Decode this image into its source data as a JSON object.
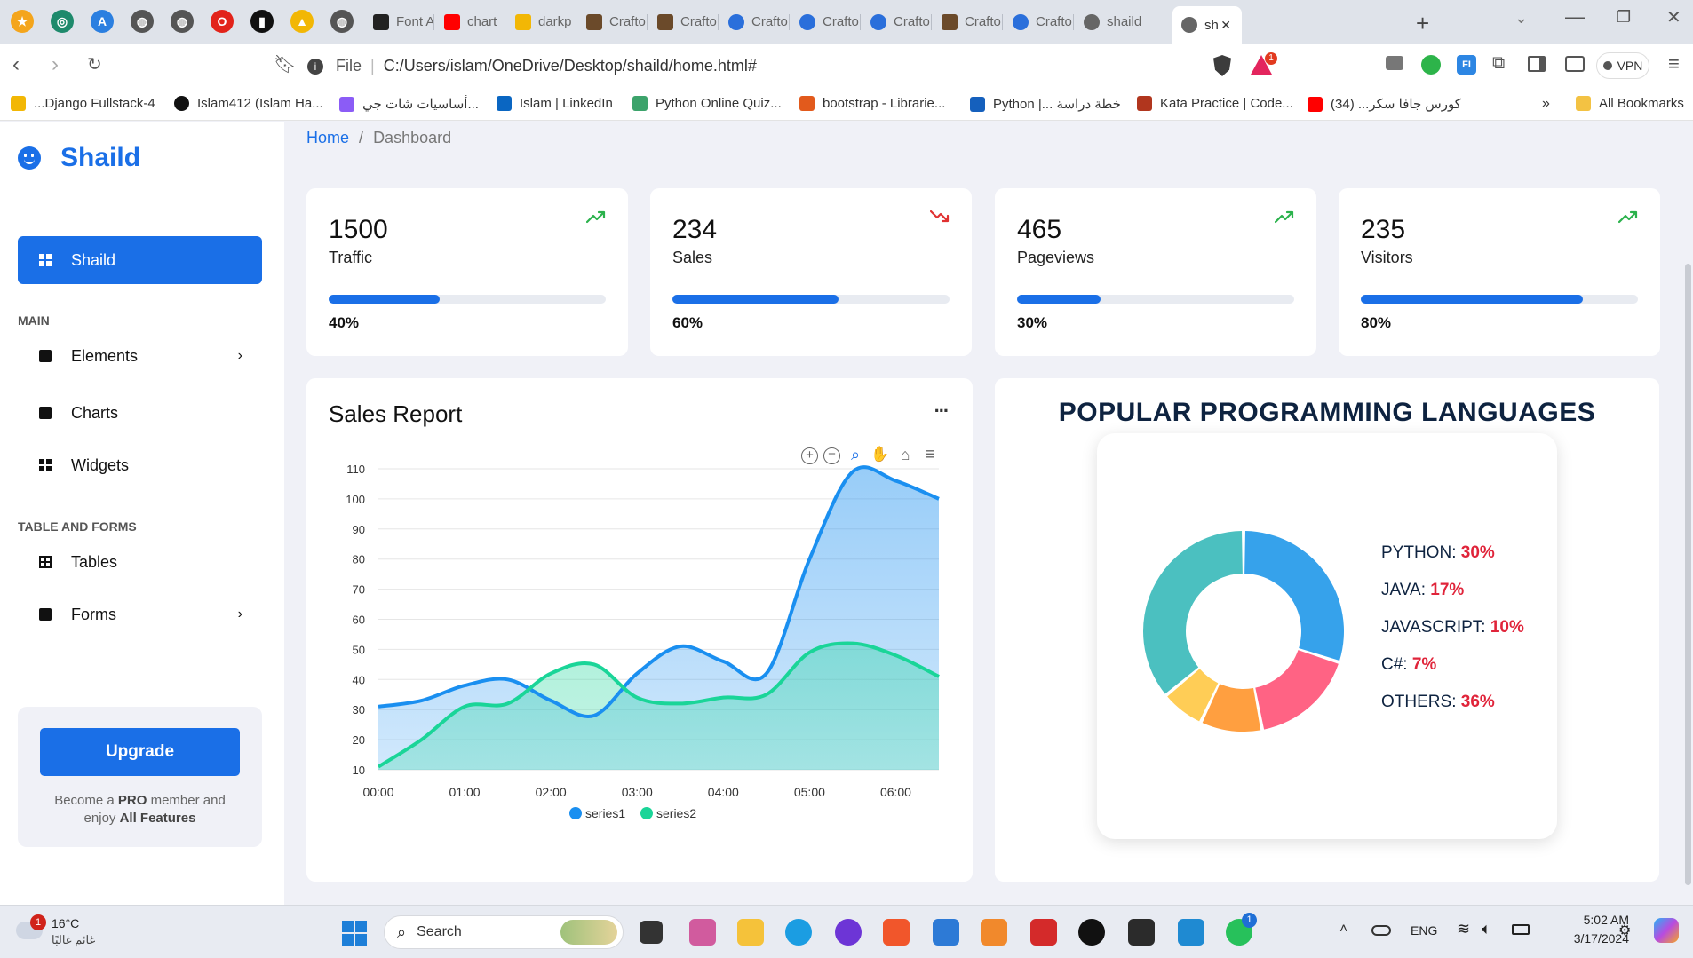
{
  "browser": {
    "tabs": [
      {
        "label": "Font A",
        "icon": "page-icon"
      },
      {
        "label": "chart",
        "icon": "youtube-icon"
      },
      {
        "label": "darkp",
        "icon": "drive-icon"
      },
      {
        "label": "Crafto",
        "icon": "crafto-icon"
      },
      {
        "label": "Crafto",
        "icon": "crafto-icon"
      },
      {
        "label": "Crafto",
        "icon": "crafto-c-icon"
      },
      {
        "label": "Crafto",
        "icon": "crafto-c-icon"
      },
      {
        "label": "Crafto",
        "icon": "crafto-c-icon"
      },
      {
        "label": "Crafto",
        "icon": "crafto-icon"
      },
      {
        "label": "Crafto",
        "icon": "crafto-c-icon"
      },
      {
        "label": "shaild",
        "icon": "globe-icon"
      },
      {
        "label": "sh",
        "icon": "globe-icon",
        "active": true
      }
    ],
    "url_scheme": "File",
    "url": "C:/Users/islam/OneDrive/Desktop/shaild/home.html#",
    "vpn_label": "VPN",
    "bookmarks": [
      "...Django Fullstack-4",
      "Islam412 (Islam Ha...",
      "أساسيات شات جي...",
      "Islam | LinkedIn",
      "Python Online Quiz...",
      "bootstrap - Librarie...",
      "Python |... خطة دراسة",
      "Kata Practice | Code...",
      "كورس جافا سكر... (34)"
    ],
    "all_bookmarks": "All Bookmarks",
    "brave_badge": "1"
  },
  "sidebar": {
    "brand": "Shaild",
    "active_item": "Shaild",
    "section_main": "MAIN",
    "main_items": [
      "Elements",
      "Charts",
      "Widgets"
    ],
    "section_tables": "TABLE AND FORMS",
    "table_items": [
      "Tables",
      "Forms"
    ],
    "upgrade_button": "Upgrade",
    "upgrade_text_1": "Become a ",
    "upgrade_text_pro": "PRO",
    "upgrade_text_2": " member and",
    "upgrade_text_3": "enjoy ",
    "upgrade_text_all": "All Features"
  },
  "breadcrumb": {
    "home": "Home",
    "separator": "/",
    "current": "Dashboard"
  },
  "kpis": [
    {
      "value": "1500",
      "label": "Traffic",
      "progress": 40,
      "progress_label": "40%",
      "trend": "up"
    },
    {
      "value": "234",
      "label": "Sales",
      "progress": 60,
      "progress_label": "60%",
      "trend": "down"
    },
    {
      "value": "465",
      "label": "Pageviews",
      "progress": 30,
      "progress_label": "30%",
      "trend": "up"
    },
    {
      "value": "235",
      "label": "Visitors",
      "progress": 80,
      "progress_label": "80%",
      "trend": "up"
    }
  ],
  "sales_report": {
    "title": "Sales Report",
    "menu": "...",
    "chart_data": {
      "type": "area",
      "x": [
        "00:00",
        "01:00",
        "02:00",
        "03:00",
        "04:00",
        "05:00",
        "06:00"
      ],
      "xlim": [
        0,
        6.5
      ],
      "x_points": [
        0,
        0.5,
        1,
        1.5,
        2,
        2.5,
        3,
        3.5,
        4,
        4.5,
        5,
        5.5,
        6,
        6.5
      ],
      "ylim": [
        10,
        110
      ],
      "yticks": [
        10,
        20,
        30,
        40,
        50,
        60,
        70,
        80,
        90,
        100,
        110
      ],
      "grid": true,
      "legend": "bottom",
      "series": [
        {
          "name": "series1",
          "color": "#1a8ff0",
          "values": [
            31,
            33,
            38,
            40,
            33,
            28,
            42,
            51,
            46,
            42,
            80,
            109,
            106,
            100
          ]
        },
        {
          "name": "series2",
          "color": "#1ad598",
          "values": [
            11,
            20,
            31,
            32,
            42,
            45,
            34,
            32,
            34,
            35,
            49,
            52,
            48,
            41
          ]
        }
      ]
    }
  },
  "languages": {
    "title": "POPULAR PROGRAMMING LANGUAGES",
    "chart_data": {
      "type": "pie",
      "labels": [
        "PYTHON",
        "JAVA",
        "JAVASCRIPT",
        "C#",
        "OTHERS"
      ],
      "values": [
        30,
        17,
        10,
        7,
        36
      ],
      "value_labels": [
        "30%",
        "17%",
        "10%",
        "7%",
        "36%"
      ],
      "colors": [
        "#36a2eb",
        "#ff6384",
        "#ff9f40",
        "#ffcd56",
        "#4bc0c0"
      ]
    }
  },
  "taskbar": {
    "weather_temp": "16°C",
    "weather_desc": "غائم غالبًا",
    "weather_badge": "1",
    "search": "Search",
    "lang": "ENG",
    "time": "5:02 AM",
    "date": "3/17/2024",
    "whatsapp_badge": "1"
  }
}
